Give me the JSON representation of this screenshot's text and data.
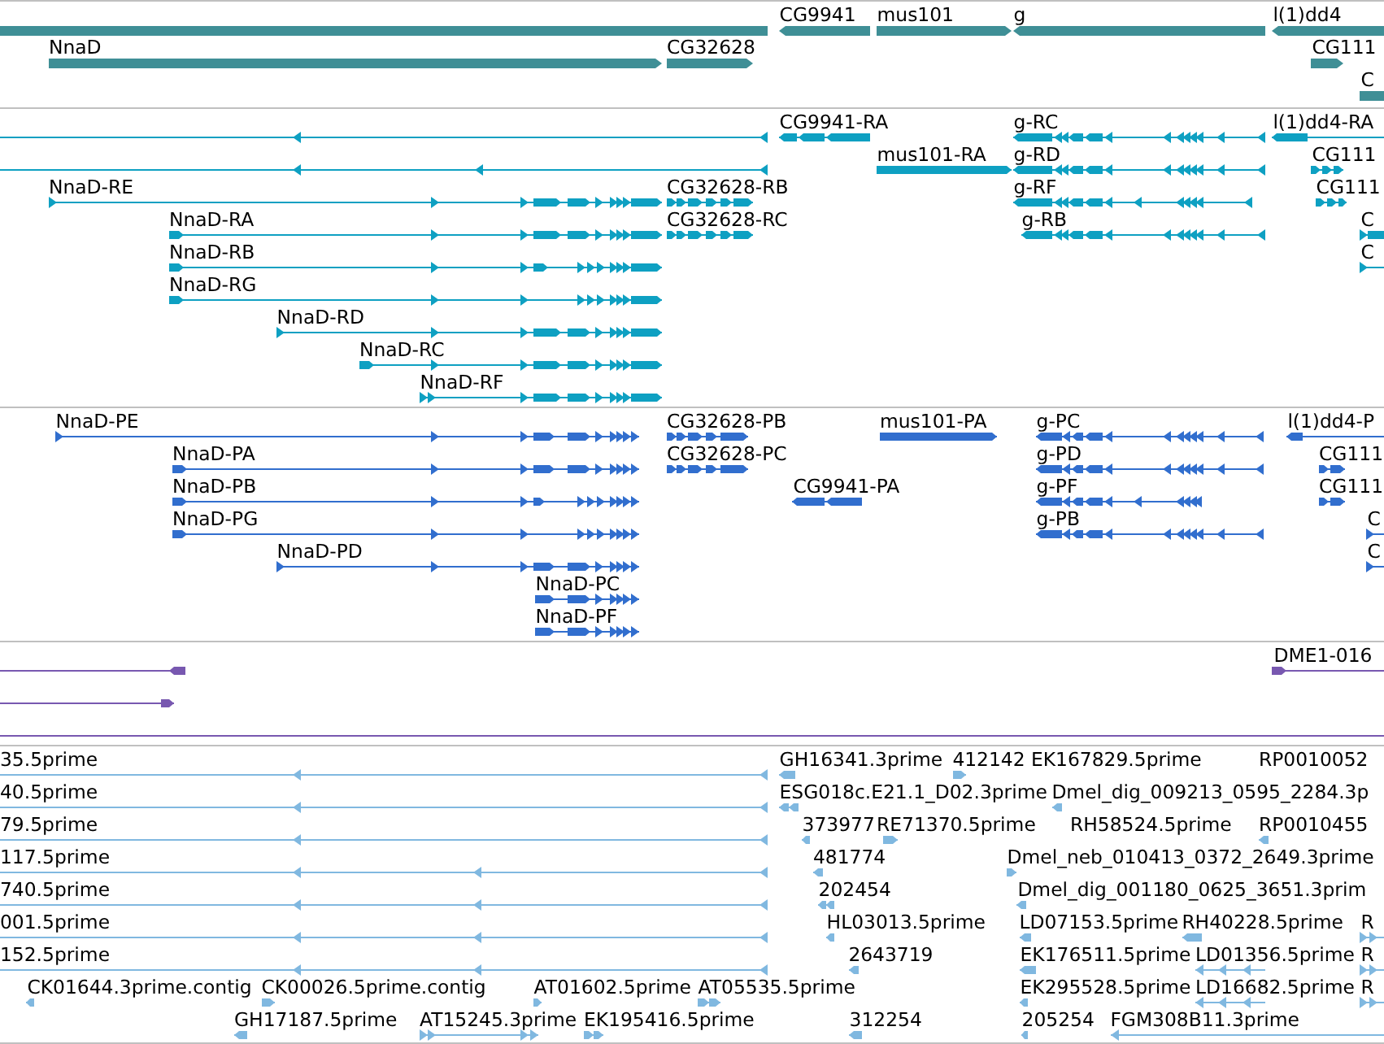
{
  "tracks": [
    {
      "kind": "gene",
      "color": "#3f8f96",
      "lanes": [
        {
          "features": [
            {
              "reverse": true
            },
            {
              "label": "CG9941",
              "reverse": true
            },
            {
              "label": "mus101",
              "reverse": false
            },
            {
              "label": "g",
              "reverse": true
            },
            {
              "label": "l(1)dd4",
              "reverse": true
            }
          ]
        },
        {
          "features": [
            {
              "label": "NnaD",
              "reverse": false
            },
            {
              "label": "CG32628",
              "reverse": false
            },
            {
              "label": "CG111",
              "reverse": false
            }
          ]
        },
        {
          "features": [
            {
              "label": "C",
              "reverse": false
            }
          ]
        }
      ]
    },
    {
      "kind": "transcript",
      "color": "#0ea0c2",
      "lanes": [
        {
          "features": [
            {
              "reverse": true
            },
            {
              "label": "CG9941-RA",
              "reverse": true
            },
            {
              "label": "g-RC",
              "reverse": true
            },
            {
              "label": "l(1)dd4-RA",
              "reverse": true
            }
          ]
        },
        {
          "features": [
            {
              "reverse": true
            },
            {
              "label": "mus101-RA",
              "reverse": false
            },
            {
              "label": "g-RD",
              "reverse": true
            },
            {
              "label": "CG111",
              "reverse": false
            }
          ]
        },
        {
          "features": [
            {
              "label": "NnaD-RE",
              "reverse": false
            },
            {
              "label": "CG32628-RB",
              "reverse": false
            },
            {
              "label": "g-RF",
              "reverse": true
            },
            {
              "label": "CG111",
              "reverse": false
            }
          ]
        },
        {
          "features": [
            {
              "label": "NnaD-RA",
              "reverse": false
            },
            {
              "label": "CG32628-RC",
              "reverse": false
            },
            {
              "label": "g-RB",
              "reverse": true
            },
            {
              "label": "C",
              "reverse": false
            }
          ]
        },
        {
          "features": [
            {
              "label": "NnaD-RB",
              "reverse": false
            },
            {
              "label": "C",
              "reverse": false
            }
          ]
        },
        {
          "features": [
            {
              "label": "NnaD-RG",
              "reverse": false
            }
          ]
        },
        {
          "features": [
            {
              "label": "NnaD-RD",
              "reverse": false
            }
          ]
        },
        {
          "features": [
            {
              "label": "NnaD-RC",
              "reverse": false
            }
          ]
        },
        {
          "features": [
            {
              "label": "NnaD-RF",
              "reverse": false
            }
          ]
        }
      ]
    },
    {
      "kind": "protein",
      "color": "#316ece",
      "lanes": [
        {
          "features": [
            {
              "label": "NnaD-PE",
              "reverse": false
            },
            {
              "label": "CG32628-PB",
              "reverse": false
            },
            {
              "label": "mus101-PA",
              "reverse": false
            },
            {
              "label": "g-PC",
              "reverse": true
            },
            {
              "label": "l(1)dd4-P",
              "reverse": true
            }
          ]
        },
        {
          "features": [
            {
              "label": "NnaD-PA",
              "reverse": false
            },
            {
              "label": "CG32628-PC",
              "reverse": false
            },
            {
              "label": "g-PD",
              "reverse": true
            },
            {
              "label": "CG111",
              "reverse": false
            }
          ]
        },
        {
          "features": [
            {
              "label": "NnaD-PB",
              "reverse": false
            },
            {
              "label": "CG9941-PA",
              "reverse": true
            },
            {
              "label": "g-PF",
              "reverse": true
            },
            {
              "label": "CG111",
              "reverse": false
            }
          ]
        },
        {
          "features": [
            {
              "label": "NnaD-PG",
              "reverse": false
            },
            {
              "label": "g-PB",
              "reverse": true
            },
            {
              "label": "C",
              "reverse": false
            }
          ]
        },
        {
          "features": [
            {
              "label": "NnaD-PD",
              "reverse": false
            },
            {
              "label": "C",
              "reverse": false
            }
          ]
        },
        {
          "features": [
            {
              "label": "NnaD-PC",
              "reverse": false
            }
          ]
        },
        {
          "features": [
            {
              "label": "NnaD-PF",
              "reverse": false
            }
          ]
        }
      ]
    },
    {
      "kind": "match",
      "color": "#7858b0",
      "lanes": [
        {
          "features": [
            {
              "reverse": true
            },
            {
              "label": "DME1-016",
              "reverse": false
            }
          ]
        },
        {
          "features": [
            {
              "reverse": false
            }
          ]
        }
      ]
    },
    {
      "kind": "est",
      "color": "#80b8e0",
      "lanes": [
        {
          "features": [
            {
              "label": "35.5prime",
              "reverse": true
            },
            {
              "label": "GH16341.3prime",
              "reverse": true
            },
            {
              "label": "412142",
              "reverse": false
            },
            {
              "label": "EK167829.5prime"
            },
            {
              "label": "RP0010052"
            }
          ]
        },
        {
          "features": [
            {
              "label": "40.5prime",
              "reverse": true
            },
            {
              "label": "ESG018c.E21.1_D02.3prime",
              "reverse": true
            },
            {
              "label": "Dmel_dig_009213_0595_2284.3p",
              "reverse": true
            }
          ]
        },
        {
          "features": [
            {
              "label": "79.5prime",
              "reverse": true
            },
            {
              "label": "373977",
              "reverse": true
            },
            {
              "label": "RE71370.5prime",
              "reverse": false
            },
            {
              "label": "RH58524.5prime"
            },
            {
              "label": "RP0010455",
              "reverse": true
            }
          ]
        },
        {
          "features": [
            {
              "label": "117.5prime",
              "reverse": true
            },
            {
              "label": "481774",
              "reverse": true
            },
            {
              "label": "Dmel_neb_010413_0372_2649.3prime",
              "reverse": false
            }
          ]
        },
        {
          "features": [
            {
              "label": "740.5prime",
              "reverse": true
            },
            {
              "label": "202454",
              "reverse": true
            },
            {
              "label": "Dmel_dig_001180_0625_3651.3prim",
              "reverse": true
            }
          ]
        },
        {
          "features": [
            {
              "label": "001.5prime",
              "reverse": true
            },
            {
              "label": "HL03013.5prime",
              "reverse": true
            },
            {
              "label": "LD07153.5prime",
              "reverse": true
            },
            {
              "label": "RH40228.5prime",
              "reverse": true
            },
            {
              "label": "R",
              "reverse": false
            }
          ]
        },
        {
          "features": [
            {
              "label": "152.5prime",
              "reverse": true
            },
            {
              "label": "2643719",
              "reverse": true
            },
            {
              "label": "EK176511.5prime",
              "reverse": true
            },
            {
              "label": "LD01356.5prime",
              "reverse": true
            },
            {
              "label": "R",
              "reverse": false
            }
          ]
        },
        {
          "features": [
            {
              "label": "CK01644.3prime.contig",
              "reverse": true
            },
            {
              "label": "CK00026.5prime.contig",
              "reverse": false
            },
            {
              "label": "AT01602.5prime",
              "reverse": false
            },
            {
              "label": "AT05535.5prime",
              "reverse": false
            },
            {
              "label": "EK295528.5prime",
              "reverse": true
            },
            {
              "label": "LD16682.5prime",
              "reverse": true
            },
            {
              "label": "R",
              "reverse": false
            }
          ]
        },
        {
          "features": [
            {
              "label": "GH17187.5prime",
              "reverse": true
            },
            {
              "label": "AT15245.3prime",
              "reverse": false
            },
            {
              "label": "EK195416.5prime",
              "reverse": false
            },
            {
              "label": "312254",
              "reverse": true
            },
            {
              "label": "205254",
              "reverse": true
            },
            {
              "label": "FGM308B11.3prime",
              "reverse": true
            }
          ]
        }
      ]
    }
  ]
}
